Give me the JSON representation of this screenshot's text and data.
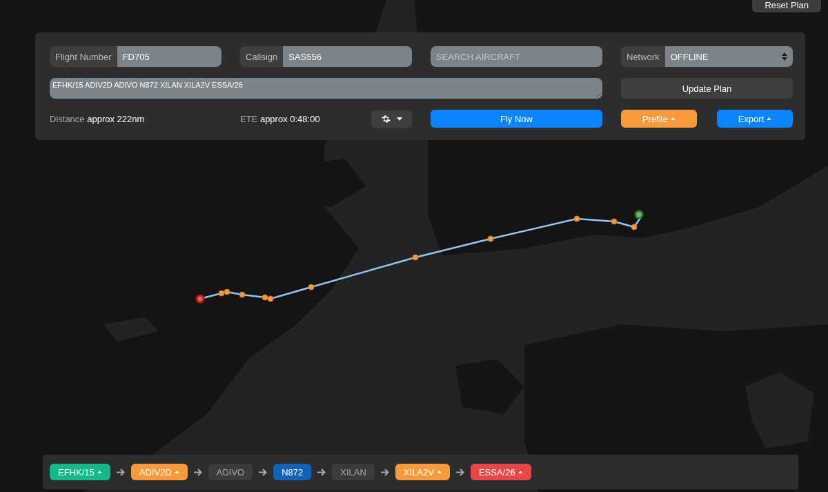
{
  "reset_button": "Reset Plan",
  "plan": {
    "flight_number": {
      "label": "Flight Number",
      "value": "FD705"
    },
    "callsign": {
      "label": "Callsign",
      "value": "SAS556"
    },
    "search": {
      "placeholder": "SEARCH AIRCRAFT"
    },
    "network": {
      "label": "Network",
      "value": "OFFLINE"
    },
    "route": "EFHK/15 ADIV2D ADIVO N872 XILAN XILA2V ESSA/26",
    "update_button": "Update Plan",
    "distance": {
      "label": "Distance",
      "value": "approx 222nm"
    },
    "ete": {
      "label": "ETE",
      "value": "approx 0:48:00"
    },
    "fly_button": "Fly Now",
    "prefile_button": "Prefile",
    "export_button": "Export"
  },
  "route_chips": [
    {
      "label": "EFHK/15",
      "kind": "filled",
      "color": "#14b98a",
      "expandable": true
    },
    {
      "label": "ADIV2D",
      "kind": "filled",
      "color": "#f89a3a",
      "expandable": true
    },
    {
      "label": "ADIVO",
      "kind": "muted",
      "color": "#3b3b3b",
      "expandable": false
    },
    {
      "label": "N872",
      "kind": "filled",
      "color": "#1463b8",
      "expandable": false
    },
    {
      "label": "XILAN",
      "kind": "muted",
      "color": "#3b3b3b",
      "expandable": false
    },
    {
      "label": "XILA2V",
      "kind": "filled",
      "color": "#f89a3a",
      "expandable": true
    },
    {
      "label": "ESSA/26",
      "kind": "filled",
      "color": "#e84545",
      "expandable": true
    }
  ]
}
